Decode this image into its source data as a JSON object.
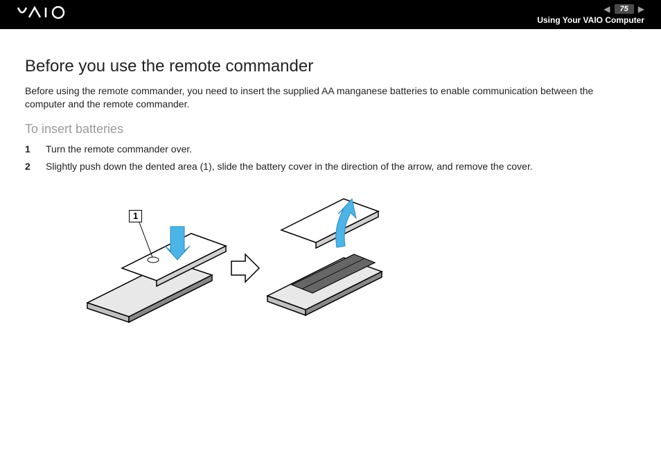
{
  "header": {
    "logo_text": "VAIO",
    "page_number": "75",
    "section_title": "Using Your VAIO Computer"
  },
  "content": {
    "heading": "Before you use the remote commander",
    "intro_paragraph": "Before using the remote commander, you need to insert the supplied AA manganese batteries to enable communication between the computer and the remote commander.",
    "subheading": "To insert batteries",
    "steps": [
      {
        "num": "1",
        "text": "Turn the remote commander over."
      },
      {
        "num": "2",
        "text": "Slightly push down the dented area (1), slide the battery cover in the direction of the arrow, and remove the cover."
      }
    ],
    "illustration": {
      "callout_1": "1"
    }
  }
}
